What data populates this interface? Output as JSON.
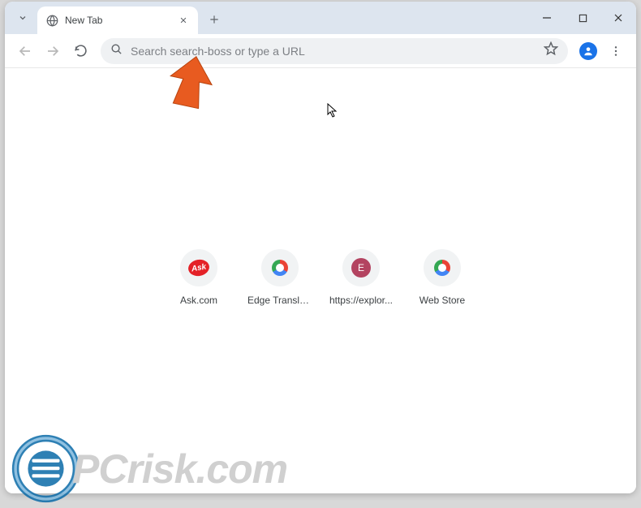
{
  "tab": {
    "title": "New Tab"
  },
  "omnibox": {
    "placeholder": "Search search-boss or type a URL"
  },
  "shortcuts": [
    {
      "label": "Ask.com",
      "icon": "ask"
    },
    {
      "label": "Edge Translate",
      "icon": "chrome"
    },
    {
      "label": "https://explor...",
      "icon": "letter",
      "letter": "E"
    },
    {
      "label": "Web Store",
      "icon": "chrome"
    }
  ],
  "watermark": "PCrisk.com"
}
